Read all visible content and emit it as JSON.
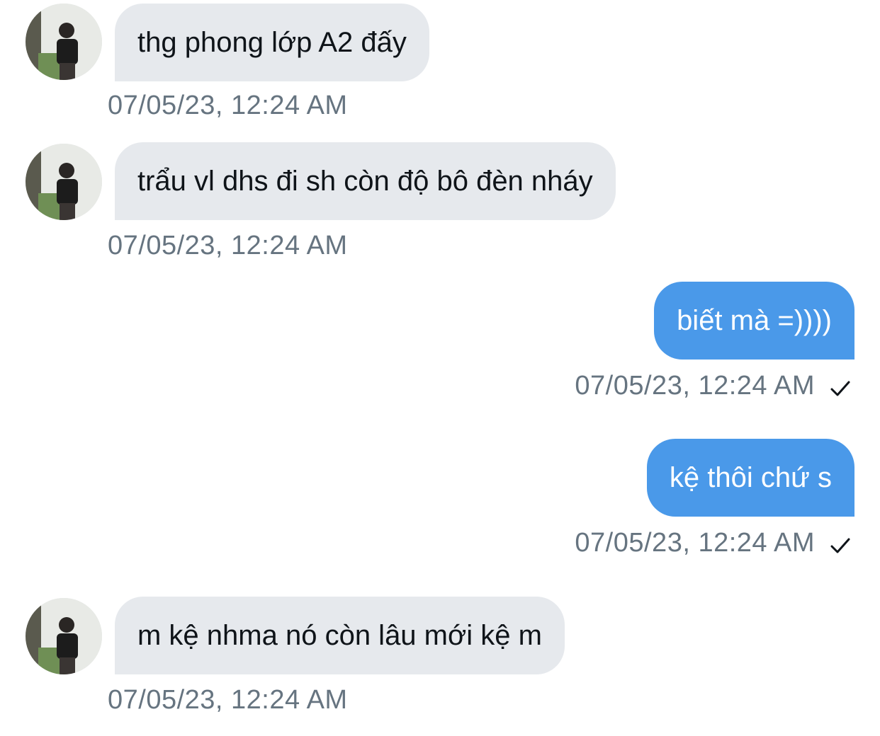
{
  "conversation": {
    "messages": [
      {
        "direction": "incoming",
        "text": "thg phong lớp A2 đấy",
        "timestamp": "07/05/23, 12:24 AM"
      },
      {
        "direction": "incoming",
        "text": "trẩu vl dhs đi sh còn độ bô đèn nháy",
        "timestamp": "07/05/23, 12:24 AM"
      },
      {
        "direction": "outgoing",
        "text": "biết mà =))))",
        "timestamp": "07/05/23, 12:24 AM",
        "status_icon": "check-icon"
      },
      {
        "direction": "outgoing",
        "text": "kệ thôi chứ s",
        "timestamp": "07/05/23, 12:24 AM",
        "status_icon": "check-icon"
      },
      {
        "direction": "incoming",
        "text": "m kệ nhma nó còn lâu mới kệ m",
        "timestamp": "07/05/23, 12:24 AM"
      }
    ]
  },
  "colors": {
    "incoming_bubble": "#e6e9ed",
    "outgoing_bubble": "#4a99e9",
    "timestamp_text": "#667480",
    "incoming_text": "#0f1419",
    "outgoing_text": "#ffffff"
  }
}
